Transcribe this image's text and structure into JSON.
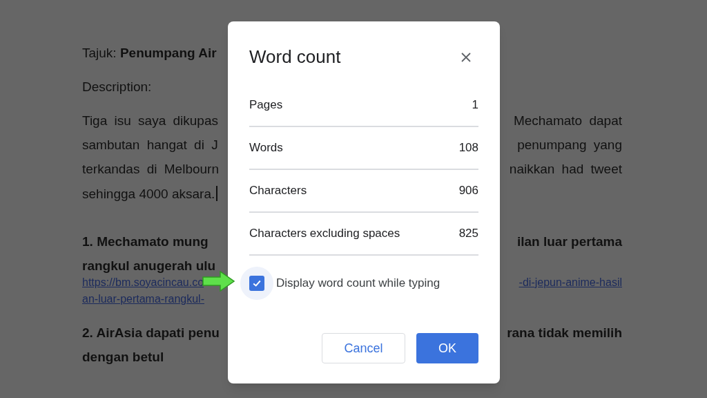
{
  "document": {
    "lines": [
      {
        "kind": "text",
        "left": "Tajuk: **Penumpang Air**"
      },
      {
        "kind": "text",
        "left": "Description:"
      },
      {
        "kind": "para",
        "left": "Tiga isu saya dikupas",
        "right": "Mechamato dapat"
      },
      {
        "kind": "para",
        "left": "sambutan hangat di J",
        "right": "penumpang yang"
      },
      {
        "kind": "para",
        "left": "terkandas di Melbourn",
        "right": "naikkan had tweet"
      },
      {
        "kind": "cursor",
        "left": "sehingga 4000 aksara."
      },
      {
        "kind": "heading",
        "left": "1. **Mechamato mung**",
        "right": "ilan luar pertama"
      },
      {
        "kind": "heading",
        "left": "rangkul anugerah ulu"
      },
      {
        "kind": "link",
        "left": "https://bm.soyacincau.co",
        "right": "-di-jepun-anime-hasil"
      },
      {
        "kind": "link",
        "left": "an-luar-pertama-rangkul-"
      },
      {
        "kind": "heading",
        "left": "2. AirAsia dapati penu",
        "right": "rana tidak memilih"
      },
      {
        "kind": "heading",
        "left": "dengan betul"
      }
    ]
  },
  "dialog": {
    "title": "Word count",
    "stats": [
      {
        "label": "Pages",
        "value": "1"
      },
      {
        "label": "Words",
        "value": "108"
      },
      {
        "label": "Characters",
        "value": "906"
      },
      {
        "label": "Characters excluding spaces",
        "value": "825"
      }
    ],
    "checkbox": {
      "label": "Display word count while typing",
      "checked": true
    },
    "buttons": [
      {
        "label": "Cancel",
        "kind": "secondary"
      },
      {
        "label": "OK",
        "kind": "primary"
      }
    ]
  }
}
